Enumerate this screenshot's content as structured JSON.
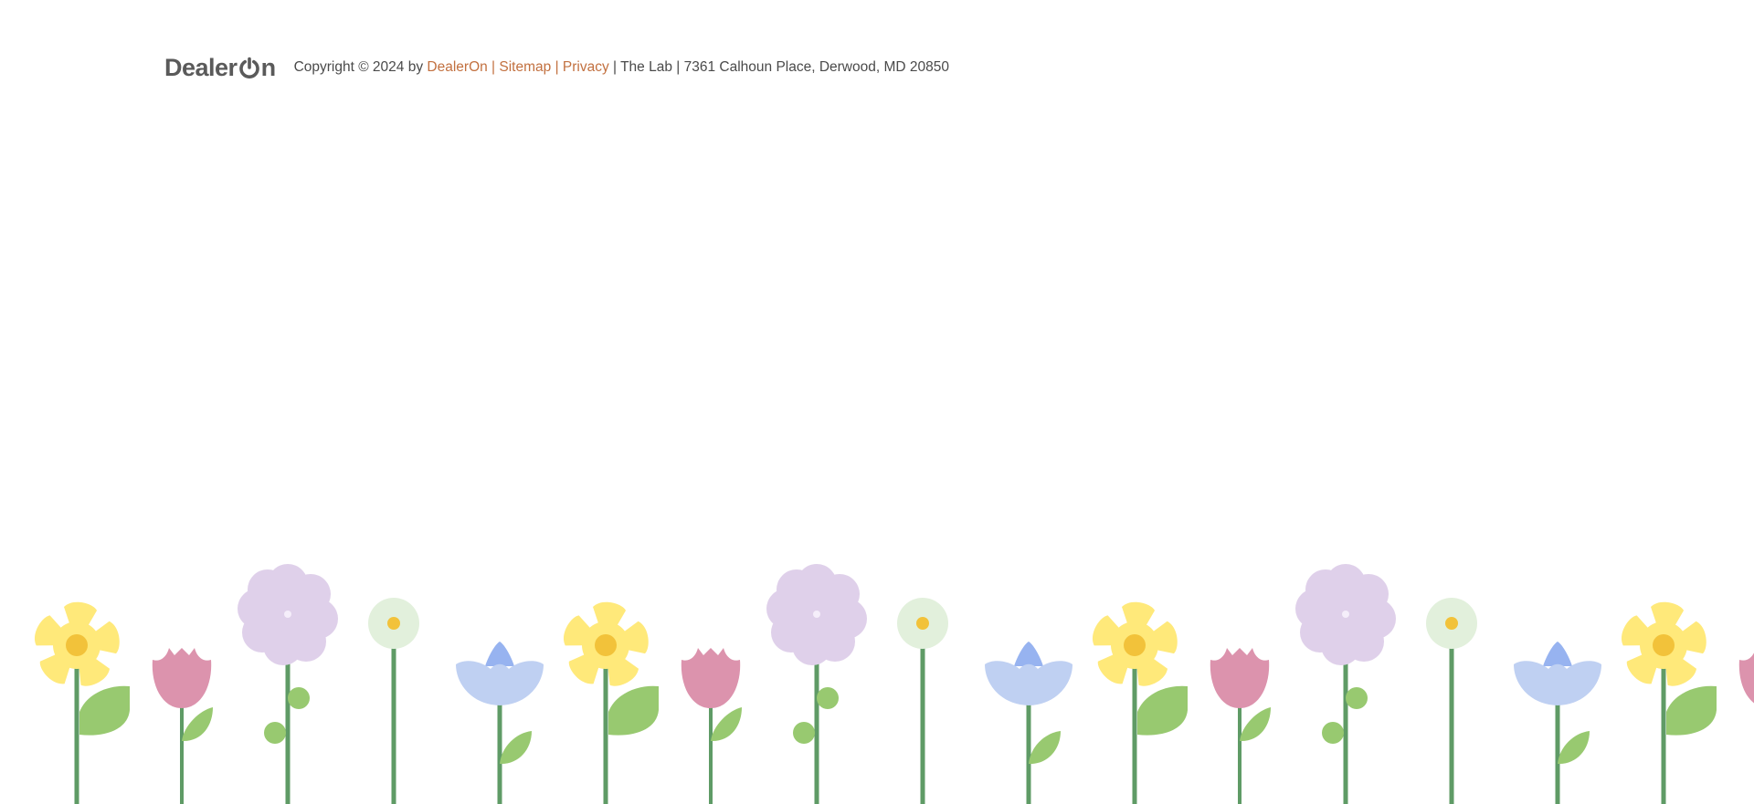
{
  "footer": {
    "logo": {
      "text_before": "Dealer",
      "text_after": "n",
      "alt": "DealerOn",
      "color": "#5a5a5a"
    },
    "copyright_prefix": "Copyright © 2024 by ",
    "links": [
      {
        "label": "DealerOn"
      },
      {
        "label": "Sitemap"
      },
      {
        "label": "Privacy"
      }
    ],
    "separator": " | ",
    "address": "The Lab | 7361 Calhoun Place, Derwood, MD 20850",
    "link_color": "#c2703f",
    "text_color": "#4a4a4a"
  },
  "decoration": {
    "name": "flower-garden-border",
    "colors": {
      "yellow_petal": "#ffe97a",
      "yellow_center": "#f2c23a",
      "pink_tulip": "#dc93ad",
      "lavender": "#dfd0ea",
      "white_daisy": "#e2f0dc",
      "blue_bell": "#bfd0f2",
      "blue_bell_top": "#97b3f0",
      "stem": "#5f9b66",
      "leaf": "#98c970"
    },
    "pattern": [
      "daffodil",
      "tulip",
      "hydrangea",
      "daisy",
      "bluebell"
    ]
  }
}
